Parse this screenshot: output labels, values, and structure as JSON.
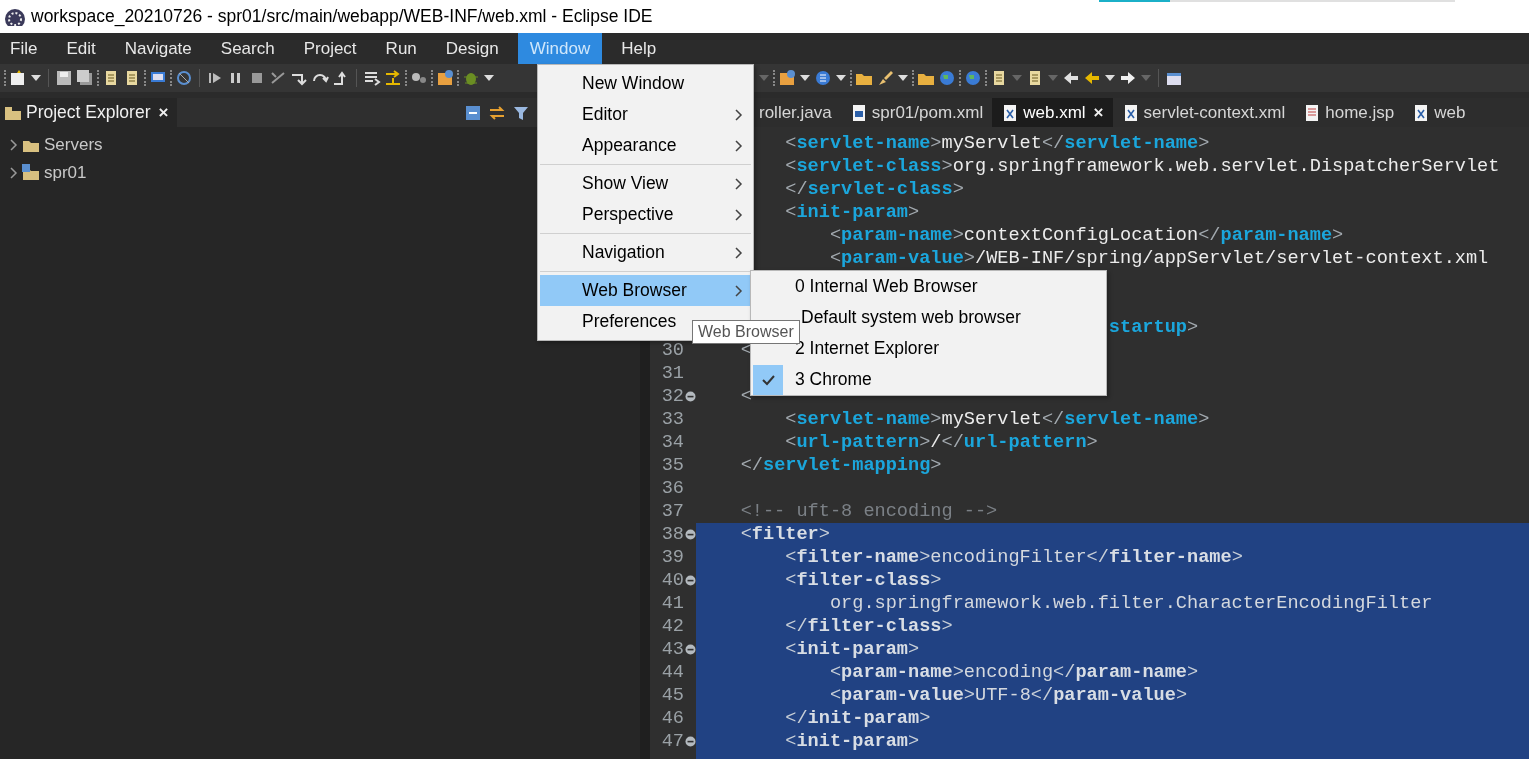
{
  "window": {
    "title": "workspace_20210726 - spr01/src/main/webapp/WEB-INF/web.xml - Eclipse IDE"
  },
  "progress": {
    "level": 0.2
  },
  "menu_bar": [
    {
      "label": "File",
      "selected": false
    },
    {
      "label": "Edit",
      "selected": false
    },
    {
      "label": "Navigate",
      "selected": false
    },
    {
      "label": "Search",
      "selected": false
    },
    {
      "label": "Project",
      "selected": false
    },
    {
      "label": "Run",
      "selected": false
    },
    {
      "label": "Design",
      "selected": false
    },
    {
      "label": "Window",
      "selected": true
    },
    {
      "label": "Help",
      "selected": false
    }
  ],
  "project_explorer": {
    "title": "Project Explorer",
    "close": "×",
    "tree": [
      {
        "label": "Servers",
        "kind": "folder",
        "expanded": false
      },
      {
        "label": "spr01",
        "kind": "project",
        "expanded": false
      }
    ]
  },
  "editor_tabs": [
    {
      "label": "roller.java",
      "selected": false
    },
    {
      "label": "spr01/pom.xml",
      "kind": "maven",
      "selected": false
    },
    {
      "label": "web.xml",
      "kind": "xml",
      "selected": true,
      "close": "×"
    },
    {
      "label": "servlet-context.xml",
      "kind": "xml",
      "selected": false
    },
    {
      "label": "home.jsp",
      "kind": "jsp",
      "selected": false
    },
    {
      "label": "web",
      "kind": "xml",
      "selected": false
    }
  ],
  "editor_lines": [
    {
      "text": "        <servlet-name>myServlet</servlet-name>",
      "selected": false
    },
    {
      "text": "        <servlet-class>org.springframework.web.servlet.DispatcherServlet",
      "selected": false
    },
    {
      "text": "        </servlet-class>",
      "selected": false
    },
    {
      "text": "        <init-param>",
      "selected": false
    },
    {
      "text": "            <param-name>contextConfigLocation</param-name>",
      "selected": false
    },
    {
      "text": "            <param-value>/WEB-INF/spring/appServlet/servlet-context.xml",
      "selected": false
    },
    {
      "selected": false
    },
    {
      "selected": false
    },
    {
      "text": "                                     startup>",
      "kind": "tag-tail",
      "selected": false
    },
    {
      "number": "30",
      "text": "    <",
      "selected": false,
      "fold": false
    },
    {
      "number": "31",
      "selected": false,
      "fold": false
    },
    {
      "number": "32",
      "text": "    <",
      "selected": false,
      "fold": true
    },
    {
      "number": "33",
      "text": "        <servlet-name>myServlet</servlet-name>",
      "selected": false,
      "fold": false
    },
    {
      "number": "34",
      "text": "        <url-pattern>/</url-pattern>",
      "selected": false,
      "fold": false
    },
    {
      "number": "35",
      "text": "    </servlet-mapping>",
      "selected": false,
      "fold": false
    },
    {
      "number": "36",
      "selected": false,
      "fold": false
    },
    {
      "number": "37",
      "text": "    <!-- uft-8 encoding -->",
      "kind": "comment",
      "selected": false,
      "fold": false
    },
    {
      "number": "38",
      "text": "    <filter>",
      "selected": true,
      "fold": true
    },
    {
      "number": "39",
      "text": "        <filter-name>encodingFilter</filter-name>",
      "selected": true,
      "fold": false
    },
    {
      "number": "40",
      "text": "        <filter-class>",
      "selected": true,
      "fold": true
    },
    {
      "number": "41",
      "text": "            org.springframework.web.filter.CharacterEncodingFilter",
      "selected": true,
      "fold": false
    },
    {
      "number": "42",
      "text": "        </filter-class>",
      "selected": true,
      "fold": false
    },
    {
      "number": "43",
      "text": "        <init-param>",
      "selected": true,
      "fold": true
    },
    {
      "number": "44",
      "text": "            <param-name>encoding</param-name>",
      "selected": true,
      "fold": false
    },
    {
      "number": "45",
      "text": "            <param-value>UTF-8</param-value>",
      "selected": true,
      "fold": false
    },
    {
      "number": "46",
      "text": "        </init-param>",
      "selected": true,
      "fold": false
    },
    {
      "number": "47",
      "text": "        <init-param>",
      "selected": true,
      "fold": true
    },
    {
      "selected": true
    }
  ],
  "window_menu": [
    {
      "kind": "item",
      "label": "New Window",
      "submenu": false,
      "selected": false
    },
    {
      "kind": "item",
      "label": "Editor",
      "submenu": true,
      "selected": false
    },
    {
      "kind": "item",
      "label": "Appearance",
      "submenu": true,
      "selected": false
    },
    {
      "kind": "separator"
    },
    {
      "kind": "item",
      "label": "Show View",
      "submenu": true,
      "selected": false
    },
    {
      "kind": "item",
      "label": "Perspective",
      "submenu": true,
      "selected": false
    },
    {
      "kind": "separator"
    },
    {
      "kind": "item",
      "label": "Navigation",
      "submenu": true,
      "selected": false
    },
    {
      "kind": "separator"
    },
    {
      "kind": "item",
      "label": "Web Browser",
      "submenu": true,
      "selected": true
    },
    {
      "kind": "item",
      "label": "Preferences",
      "submenu": false,
      "selected": false
    }
  ],
  "web_browser_submenu": [
    {
      "label": "0 Internal Web Browser",
      "checked": false
    },
    {
      "label": "Default system web browser",
      "checked": false
    },
    {
      "label": "2 Internet Explorer",
      "checked": false
    },
    {
      "label": "3 Chrome",
      "checked": true
    }
  ],
  "tooltip": "Web Browser"
}
